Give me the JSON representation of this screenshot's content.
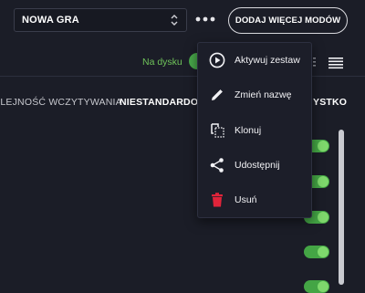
{
  "topbar": {
    "game_select": "NOWA GRA",
    "more_label": "•••",
    "add_mods_button": "DODAJ WIĘCEJ MODÓW"
  },
  "filters": {
    "on_disk_label": "Na dysku"
  },
  "columns": {
    "load_order": "OLEJNOŚĆ WCZYTYWANIA",
    "custom": "NIESTANDARDOW",
    "all": "YSTKO"
  },
  "menu": {
    "items": [
      {
        "label": "Aktywuj zestaw",
        "icon": "play-circle-icon"
      },
      {
        "label": "Zmień nazwę",
        "icon": "pencil-icon"
      },
      {
        "label": "Klonuj",
        "icon": "clone-icon"
      },
      {
        "label": "Udostępnij",
        "icon": "share-icon"
      },
      {
        "label": "Usuń",
        "icon": "trash-icon"
      }
    ]
  },
  "colors": {
    "background": "#1b1d27",
    "accent_green": "#44a545",
    "delete_red": "#e0243a"
  }
}
